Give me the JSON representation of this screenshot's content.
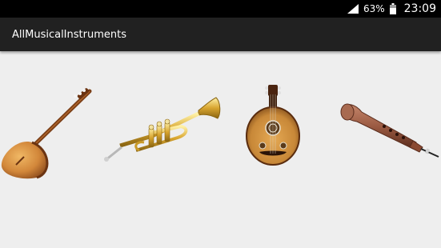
{
  "status_bar": {
    "battery_percent": "63%",
    "time": "23:09",
    "icons": [
      "signal-icon",
      "battery-icon"
    ]
  },
  "app_bar": {
    "title": "AllMusicalInstruments"
  },
  "instruments": [
    {
      "icon": "saz-icon"
    },
    {
      "icon": "trumpet-icon"
    },
    {
      "icon": "oud-icon"
    },
    {
      "icon": "zurna-icon"
    }
  ],
  "colors": {
    "status_bar": "#000000",
    "action_bar": "#212121",
    "background": "#eeeeee"
  }
}
